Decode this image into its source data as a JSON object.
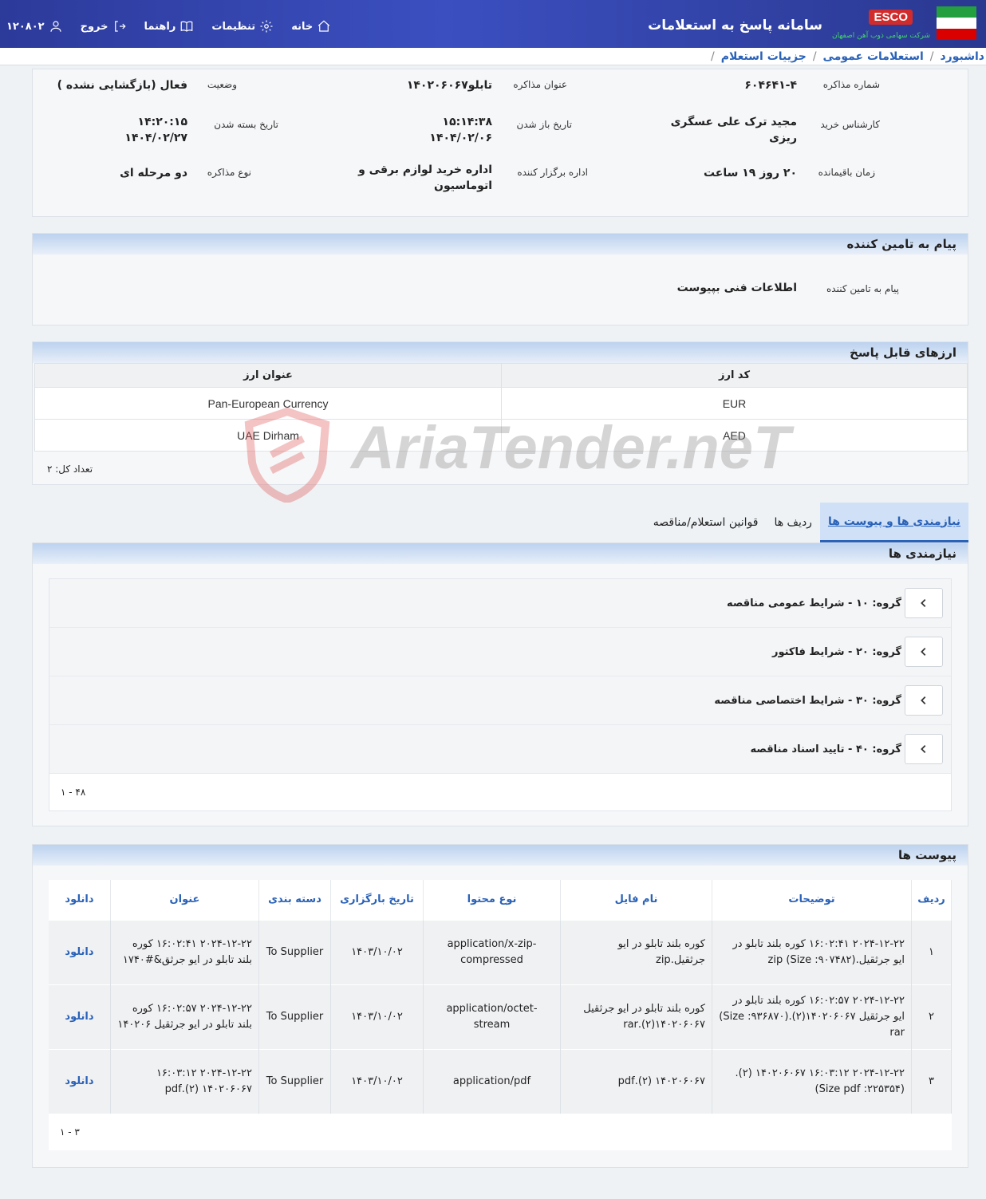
{
  "header": {
    "app_title": "سامانه پاسخ به استعلامات",
    "brand": "ESCO",
    "brand_sub": "شرکت سهامی ذوب آهن اصفهان",
    "nav": {
      "home": "خانه",
      "settings": "تنظیمات",
      "guide": "راهنما",
      "logout": "خروج",
      "user_id": "۱۲۰۸۰۲"
    }
  },
  "breadcrumb": [
    "داشبورد",
    "استعلامات عمومی",
    "جزییات استعلام"
  ],
  "info": {
    "negotiation_no_label": "شماره مذاکره",
    "negotiation_no": "۶۰۴۶۴۱-۴",
    "title_label": "عنوان مذاکره",
    "title": "تابلو۱۴۰۲۰۶۰۶۷",
    "status_label": "وضعیت",
    "status": "فعال (بازگشایی نشده )",
    "buyer_label": "کارشناس خرید",
    "buyer": "مجید ترک علی عسگری ریزی",
    "open_label": "تاریخ باز شدن",
    "open_time": "۱۵:۱۴:۳۸",
    "open_date": "۱۴۰۴/۰۲/۰۶",
    "close_label": "تاریخ بسته شدن",
    "close_time": "۱۴:۲۰:۱۵",
    "close_date": "۱۴۰۴/۰۲/۲۷",
    "remaining_label": "زمان باقیمانده",
    "remaining": "۲۰ روز ۱۹ ساعت",
    "office_label": "اداره برگزار کننده",
    "office": "اداره خرید لوازم برقی و اتوماسیون",
    "type_label": "نوع مذاکره",
    "type": "دو مرحله ای"
  },
  "message": {
    "header": "پیام به تامین کننده",
    "label": "پیام به تامین کننده",
    "value": "اطلاعات فنی بپیوست"
  },
  "currency": {
    "header": "ارزهای قابل پاسخ",
    "col_code": "کد ارز",
    "col_title": "عنوان ارز",
    "rows": [
      {
        "code": "EUR",
        "title": "Pan-European Currency"
      },
      {
        "code": "AED",
        "title": "UAE Dirham"
      }
    ],
    "count": "تعداد کل: ۲"
  },
  "tabs": [
    "نیازمندی ها و پیوست ها",
    "ردیف ها",
    "قوانین استعلام/مناقصه"
  ],
  "needs": {
    "header": "نیازمندی ها",
    "groups": [
      "گروه: ۱۰ - شرایط عمومی مناقصه",
      "گروه: ۲۰ - شرایط فاکتور",
      "گروه: ۳۰ - شرایط اختصاصی مناقصه",
      "گروه: ۴۰ - تایید اسناد مناقصه"
    ],
    "pager": "۱ - ۴۸"
  },
  "attachments": {
    "header": "پیوست ها",
    "columns": [
      "ردیف",
      "توضیحات",
      "نام فایل",
      "نوع محتوا",
      "تاریخ بارگزاری",
      "دسته بندی",
      "عنوان",
      "دانلود"
    ],
    "rows": [
      {
        "row": "۱",
        "desc": "۲۰۲۴-۱۲-۲۲ ۱۶:۰۲:۴۱ کوره بلند تابلو در ایو جرثقیل.(Size :۹۰۷۴۸۲) zip",
        "fname": "کوره بلند تابلو در ایو جرثقیل.zip",
        "ctype": "application/x-zip-compressed",
        "date": "۱۴۰۳/۱۰/۰۲",
        "cat": "To Supplier",
        "title": "۲۰۲۴-۱۲-۲۲ ۱۶:۰۲:۴۱ کوره بلند تابلو در ایو جرثق&#۱۷۴۰",
        "dl": "دانلود"
      },
      {
        "row": "۲",
        "desc": "۲۰۲۴-۱۲-۲۲ ۱۶:۰۲:۵۷ کوره بلند تابلو در ایو جرثقیل ۱۴۰۲۰۶۰۶۷(۲).(Size :۹۳۶۸۷۰) rar",
        "fname": "کوره بلند تابلو در ایو جرثقیل ۱۴۰۲۰۶۰۶۷(۲).rar",
        "ctype": "application/octet-stream",
        "date": "۱۴۰۳/۱۰/۰۲",
        "cat": "To Supplier",
        "title": "۲۰۲۴-۱۲-۲۲ ۱۶:۰۲:۵۷ کوره بلند تابلو در ایو جرثقیل ۱۴۰۲۰۶",
        "dl": "دانلود"
      },
      {
        "row": "۳",
        "desc": "۲۰۲۴-۱۲-۲۲ ۱۶:۰۳:۱۲ ۱۴۰۲۰۶۰۶۷ (۲).(Size pdf :۲۲۵۳۵۴)",
        "fname": "۱۴۰۲۰۶۰۶۷ (۲).pdf",
        "ctype": "application/pdf",
        "date": "۱۴۰۳/۱۰/۰۲",
        "cat": "To Supplier",
        "title": "۲۰۲۴-۱۲-۲۲ ۱۶:۰۳:۱۲ ۱۴۰۲۰۶۰۶۷ (۲).pdf",
        "dl": "دانلود"
      }
    ],
    "pager": "۱ - ۳"
  },
  "watermark": "AriaTender.neT",
  "colors": {
    "header_bg": "#2c3a9a",
    "link": "#2a62b8",
    "esco_red": "#d12b2b"
  }
}
